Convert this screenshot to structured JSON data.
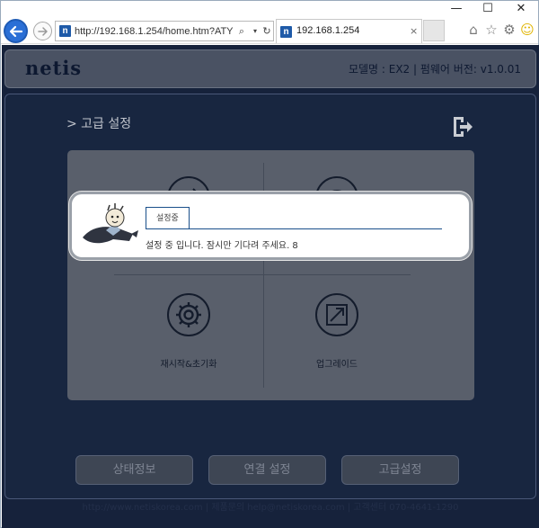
{
  "browser": {
    "window_buttons": {
      "minimize": "—",
      "maximize": "☐",
      "close": "✕"
    },
    "address": {
      "url": "http://192.168.1.254/home.htm?ATYPE"
    },
    "tab": {
      "title": "192.168.1.254",
      "close": "×"
    },
    "favicon_letter": "n",
    "icons": [
      "back-arrow-icon",
      "forward-arrow-icon",
      "search-icon",
      "dropdown-icon",
      "refresh-icon",
      "home-icon",
      "star-icon",
      "gear-icon",
      "smiley-icon"
    ]
  },
  "header": {
    "logo": "netis",
    "version_info": "모델명 : EX2 | 펌웨어 버전: v1.0.01"
  },
  "main": {
    "section_title": "> 고급 설정",
    "tiles": [
      {
        "label": "",
        "icon": "transfer-icon"
      },
      {
        "label": "",
        "icon": "speed-icon"
      },
      {
        "label": "재시작&초기화",
        "icon": "gear-icon"
      },
      {
        "label": "업그레이드",
        "icon": "expand-icon"
      }
    ]
  },
  "modal": {
    "tab_label": "설정중",
    "message": "설정 중 입니다. 잠시만 기다려 주세요. 8"
  },
  "nav_buttons": [
    "상태정보",
    "연결 설정",
    "고급설정"
  ],
  "footer": {
    "text": "http://www.netiskorea.com | 제품문의 help@netiskorea.com | 고객센터 070-4641-1290"
  },
  "colors": {
    "page_bg": "#16223b",
    "accent_blue": "#1a4f8a",
    "browser_back": "#2a6fd6"
  }
}
